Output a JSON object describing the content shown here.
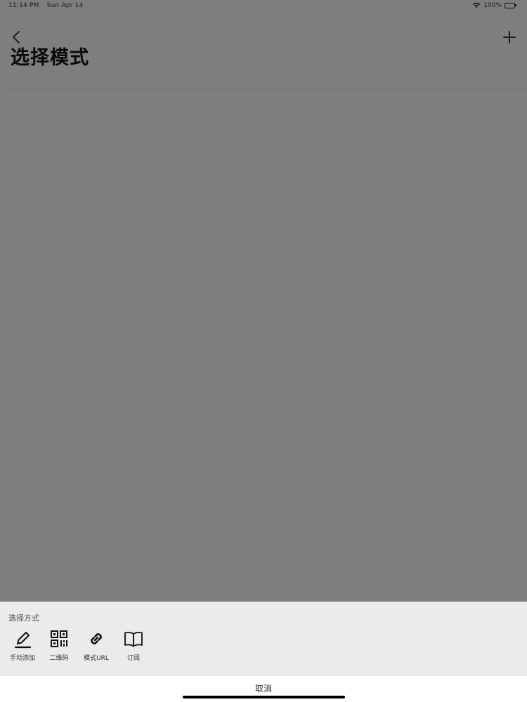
{
  "status_bar": {
    "time": "11:14 PM",
    "date": "Sun Apr 14",
    "signal_dots": "....",
    "battery_percent": "100%",
    "icons": [
      "wifi-icon",
      "battery-icon"
    ]
  },
  "nav": {
    "back_icon": "chevron-left-icon",
    "add_icon": "plus-icon",
    "title": "选择模式"
  },
  "sheet": {
    "title": "选择方式",
    "options": [
      {
        "label": "手动添加",
        "icon": "pencil-icon"
      },
      {
        "label": "二维码",
        "icon": "qr-code-icon"
      },
      {
        "label": "模式URL",
        "icon": "link-icon"
      },
      {
        "label": "订阅",
        "icon": "book-icon"
      }
    ],
    "cancel_label": "取消"
  },
  "colors": {
    "dimmed_background": "#7f7d80",
    "sheet_background": "#ebeaed",
    "cancel_background": "#ffffff"
  }
}
